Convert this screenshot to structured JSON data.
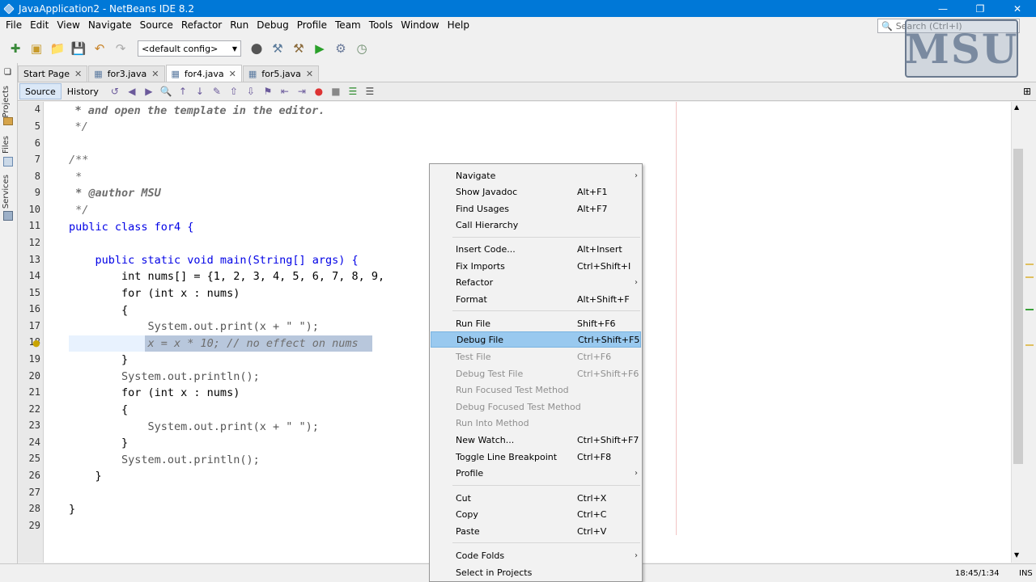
{
  "window": {
    "title": "JavaApplication2 - NetBeans IDE 8.2",
    "buttons": [
      "—",
      "❐",
      "✕"
    ]
  },
  "menubar": [
    "File",
    "Edit",
    "View",
    "Navigate",
    "Source",
    "Refactor",
    "Run",
    "Debug",
    "Profile",
    "Team",
    "Tools",
    "Window",
    "Help"
  ],
  "search": {
    "placeholder": "Search (Ctrl+I)"
  },
  "toolbar": {
    "config": "<default config>"
  },
  "watermark": "MSU",
  "side_tabs": [
    "Projects",
    "Files",
    "Services"
  ],
  "editor_tabs": [
    {
      "label": "Start Page",
      "active": false
    },
    {
      "label": "for3.java",
      "active": false
    },
    {
      "label": "for4.java",
      "active": true
    },
    {
      "label": "for5.java",
      "active": false
    }
  ],
  "editor_toolbar": {
    "source": "Source",
    "history": "History"
  },
  "code": {
    "line_numbers": [
      "4",
      "5",
      "6",
      "7",
      "8",
      "9",
      "10",
      "11",
      "12",
      "13",
      "14",
      "15",
      "16",
      "17",
      "18",
      "19",
      "20",
      "21",
      "22",
      "23",
      "24",
      "25",
      "26",
      "27",
      "28",
      "29"
    ],
    "lines": [
      "    * and open the template in the editor.",
      "    */",
      "",
      "/**",
      " *",
      " * @author MSU",
      " */",
      "public class for4 {",
      "",
      "    public static void main(String[] args) {",
      "        int nums[] = {1, 2, 3, 4, 5, 6, 7, 8, 9,",
      "        for (int x : nums)",
      "        {",
      "            System.out.print(x + \" \");",
      "            x = x * 10; // no effect on nums",
      "        }",
      "        System.out.println();",
      "        for (int x : nums)",
      "        {",
      "            System.out.print(x + \" \");",
      "        }",
      "        System.out.println();",
      "    }",
      "",
      "}",
      ""
    ]
  },
  "context_menu": {
    "items": [
      {
        "label": "Navigate",
        "shortcut": "",
        "submenu": true,
        "disabled": false
      },
      {
        "label": "Show Javadoc",
        "shortcut": "Alt+F1",
        "submenu": false,
        "disabled": false
      },
      {
        "label": "Find Usages",
        "shortcut": "Alt+F7",
        "submenu": false,
        "disabled": false
      },
      {
        "label": "Call Hierarchy",
        "shortcut": "",
        "submenu": false,
        "disabled": false
      },
      {
        "label": "Insert Code...",
        "shortcut": "Alt+Insert",
        "submenu": false,
        "disabled": false
      },
      {
        "label": "Fix Imports",
        "shortcut": "Ctrl+Shift+I",
        "submenu": false,
        "disabled": false
      },
      {
        "label": "Refactor",
        "shortcut": "",
        "submenu": true,
        "disabled": false
      },
      {
        "label": "Format",
        "shortcut": "Alt+Shift+F",
        "submenu": false,
        "disabled": false
      },
      {
        "label": "Run File",
        "shortcut": "Shift+F6",
        "submenu": false,
        "disabled": false
      },
      {
        "label": "Debug File",
        "shortcut": "Ctrl+Shift+F5",
        "submenu": false,
        "disabled": false,
        "highlighted": true
      },
      {
        "label": "Test File",
        "shortcut": "Ctrl+F6",
        "submenu": false,
        "disabled": true
      },
      {
        "label": "Debug Test File",
        "shortcut": "Ctrl+Shift+F6",
        "submenu": false,
        "disabled": true
      },
      {
        "label": "Run Focused Test Method",
        "shortcut": "",
        "submenu": false,
        "disabled": true
      },
      {
        "label": "Debug Focused Test Method",
        "shortcut": "",
        "submenu": false,
        "disabled": true
      },
      {
        "label": "Run Into Method",
        "shortcut": "",
        "submenu": false,
        "disabled": true
      },
      {
        "label": "New Watch...",
        "shortcut": "Ctrl+Shift+F7",
        "submenu": false,
        "disabled": false
      },
      {
        "label": "Toggle Line Breakpoint",
        "shortcut": "Ctrl+F8",
        "submenu": false,
        "disabled": false
      },
      {
        "label": "Profile",
        "shortcut": "",
        "submenu": true,
        "disabled": false
      },
      {
        "label": "Cut",
        "shortcut": "Ctrl+X",
        "submenu": false,
        "disabled": false
      },
      {
        "label": "Copy",
        "shortcut": "Ctrl+C",
        "submenu": false,
        "disabled": false
      },
      {
        "label": "Paste",
        "shortcut": "Ctrl+V",
        "submenu": false,
        "disabled": false
      },
      {
        "label": "Code Folds",
        "shortcut": "",
        "submenu": true,
        "disabled": false
      },
      {
        "label": "Select in Projects",
        "shortcut": "",
        "submenu": false,
        "disabled": false
      }
    ]
  },
  "status": {
    "position": "18:45/1:34",
    "mode": "INS"
  },
  "colors": {
    "titlebar": "#0078d7",
    "highlight": "#99c9ef",
    "keyword": "#0000e6"
  }
}
